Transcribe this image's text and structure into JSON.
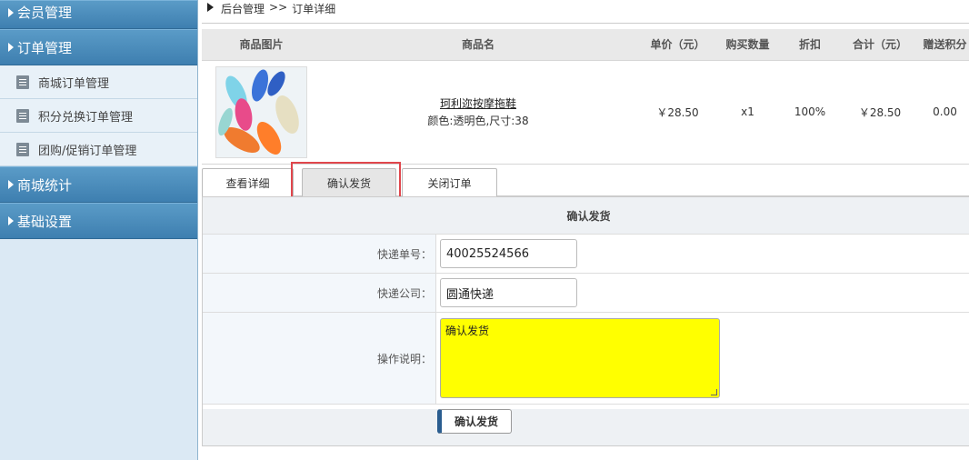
{
  "sidebar": {
    "sections": [
      {
        "label": "会员管理"
      },
      {
        "label": "订单管理"
      },
      {
        "label": "商城统计"
      },
      {
        "label": "基础设置"
      }
    ],
    "order_items": [
      {
        "label": "商城订单管理"
      },
      {
        "label": "积分兑换订单管理"
      },
      {
        "label": "团购/促销订单管理"
      }
    ]
  },
  "breadcrumb": {
    "root": "后台管理",
    "sep": ">>",
    "current": "订单详细"
  },
  "product_table": {
    "headers": [
      "商品图片",
      "商品名",
      "单价（元）",
      "购买数量",
      "折扣",
      "合计（元）",
      "赠送积分"
    ],
    "row": {
      "name": "珂利迩按摩拖鞋",
      "spec": "颜色:透明色,尺寸:38",
      "price": "￥28.50",
      "qty": "x1",
      "discount": "100%",
      "total": "￥28.50",
      "points": "0.00"
    }
  },
  "tabs": [
    {
      "label": "查看详细"
    },
    {
      "label": "确认发货"
    },
    {
      "label": "关闭订单"
    }
  ],
  "ship_form": {
    "title": "确认发货",
    "tracking_label": "快递单号：",
    "tracking_value": "40025524566",
    "company_label": "快递公司：",
    "company_value": "圆通快递",
    "note_label": "操作说明：",
    "note_value": "确认发货",
    "submit_label": "确认发货"
  },
  "colors": {
    "sidebar_header": "#3e7fb0",
    "highlight": "#e0464c",
    "textarea_bg": "#ffff00"
  }
}
